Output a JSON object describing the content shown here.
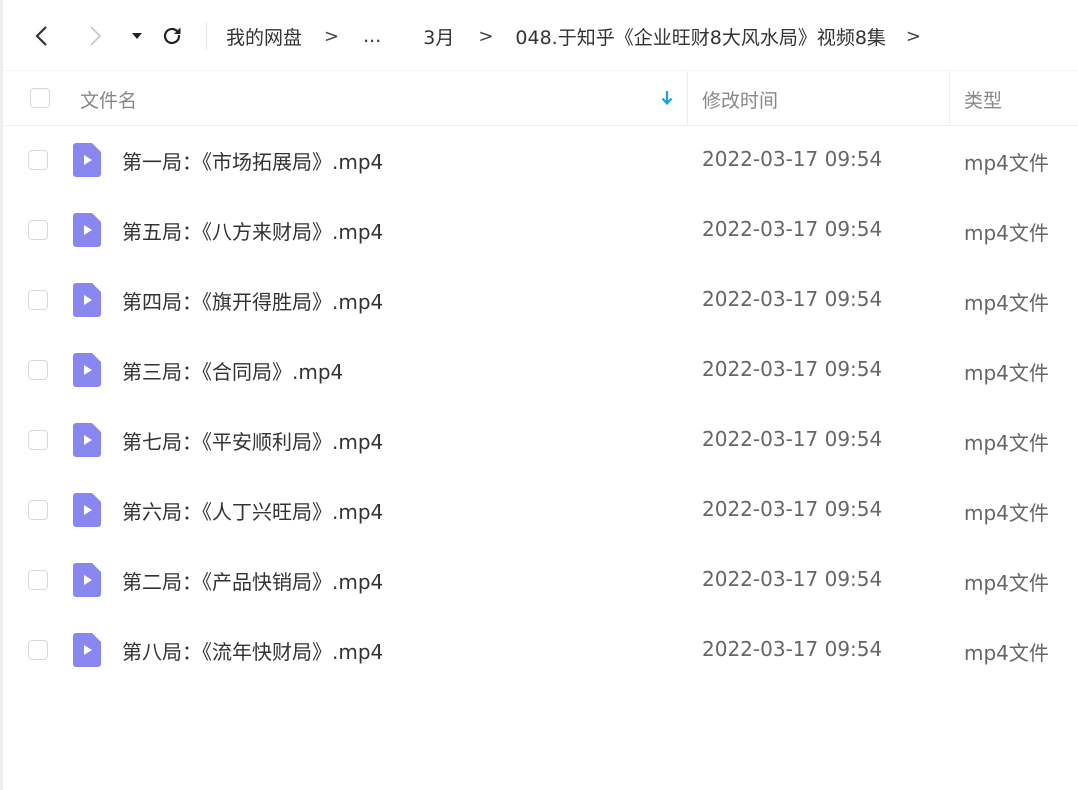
{
  "breadcrumb": {
    "root": "我的网盘",
    "ellipsis": "...",
    "month": "3月",
    "folder": "048.于知乎《企业旺财8大风水局》视频8集",
    "separator": ">"
  },
  "table": {
    "columns": {
      "name": "文件名",
      "modified": "修改时间",
      "type": "类型"
    },
    "rows": [
      {
        "name": "第一局：《市场拓展局》.mp4",
        "modified": "2022-03-17 09:54",
        "type": "mp4文件"
      },
      {
        "name": "第五局：《八方来财局》.mp4",
        "modified": "2022-03-17 09:54",
        "type": "mp4文件"
      },
      {
        "name": "第四局：《旗开得胜局》.mp4",
        "modified": "2022-03-17 09:54",
        "type": "mp4文件"
      },
      {
        "name": "第三局：《合同局》.mp4",
        "modified": "2022-03-17 09:54",
        "type": "mp4文件"
      },
      {
        "name": "第七局：《平安顺利局》.mp4",
        "modified": "2022-03-17 09:54",
        "type": "mp4文件"
      },
      {
        "name": "第六局：《人丁兴旺局》.mp4",
        "modified": "2022-03-17 09:54",
        "type": "mp4文件"
      },
      {
        "name": "第二局：《产品快销局》.mp4",
        "modified": "2022-03-17 09:54",
        "type": "mp4文件"
      },
      {
        "name": "第八局：《流年快财局》.mp4",
        "modified": "2022-03-17 09:54",
        "type": "mp4文件"
      }
    ]
  },
  "colors": {
    "video_icon": "#8a86f0",
    "sort_arrow": "#1aa0e8"
  }
}
